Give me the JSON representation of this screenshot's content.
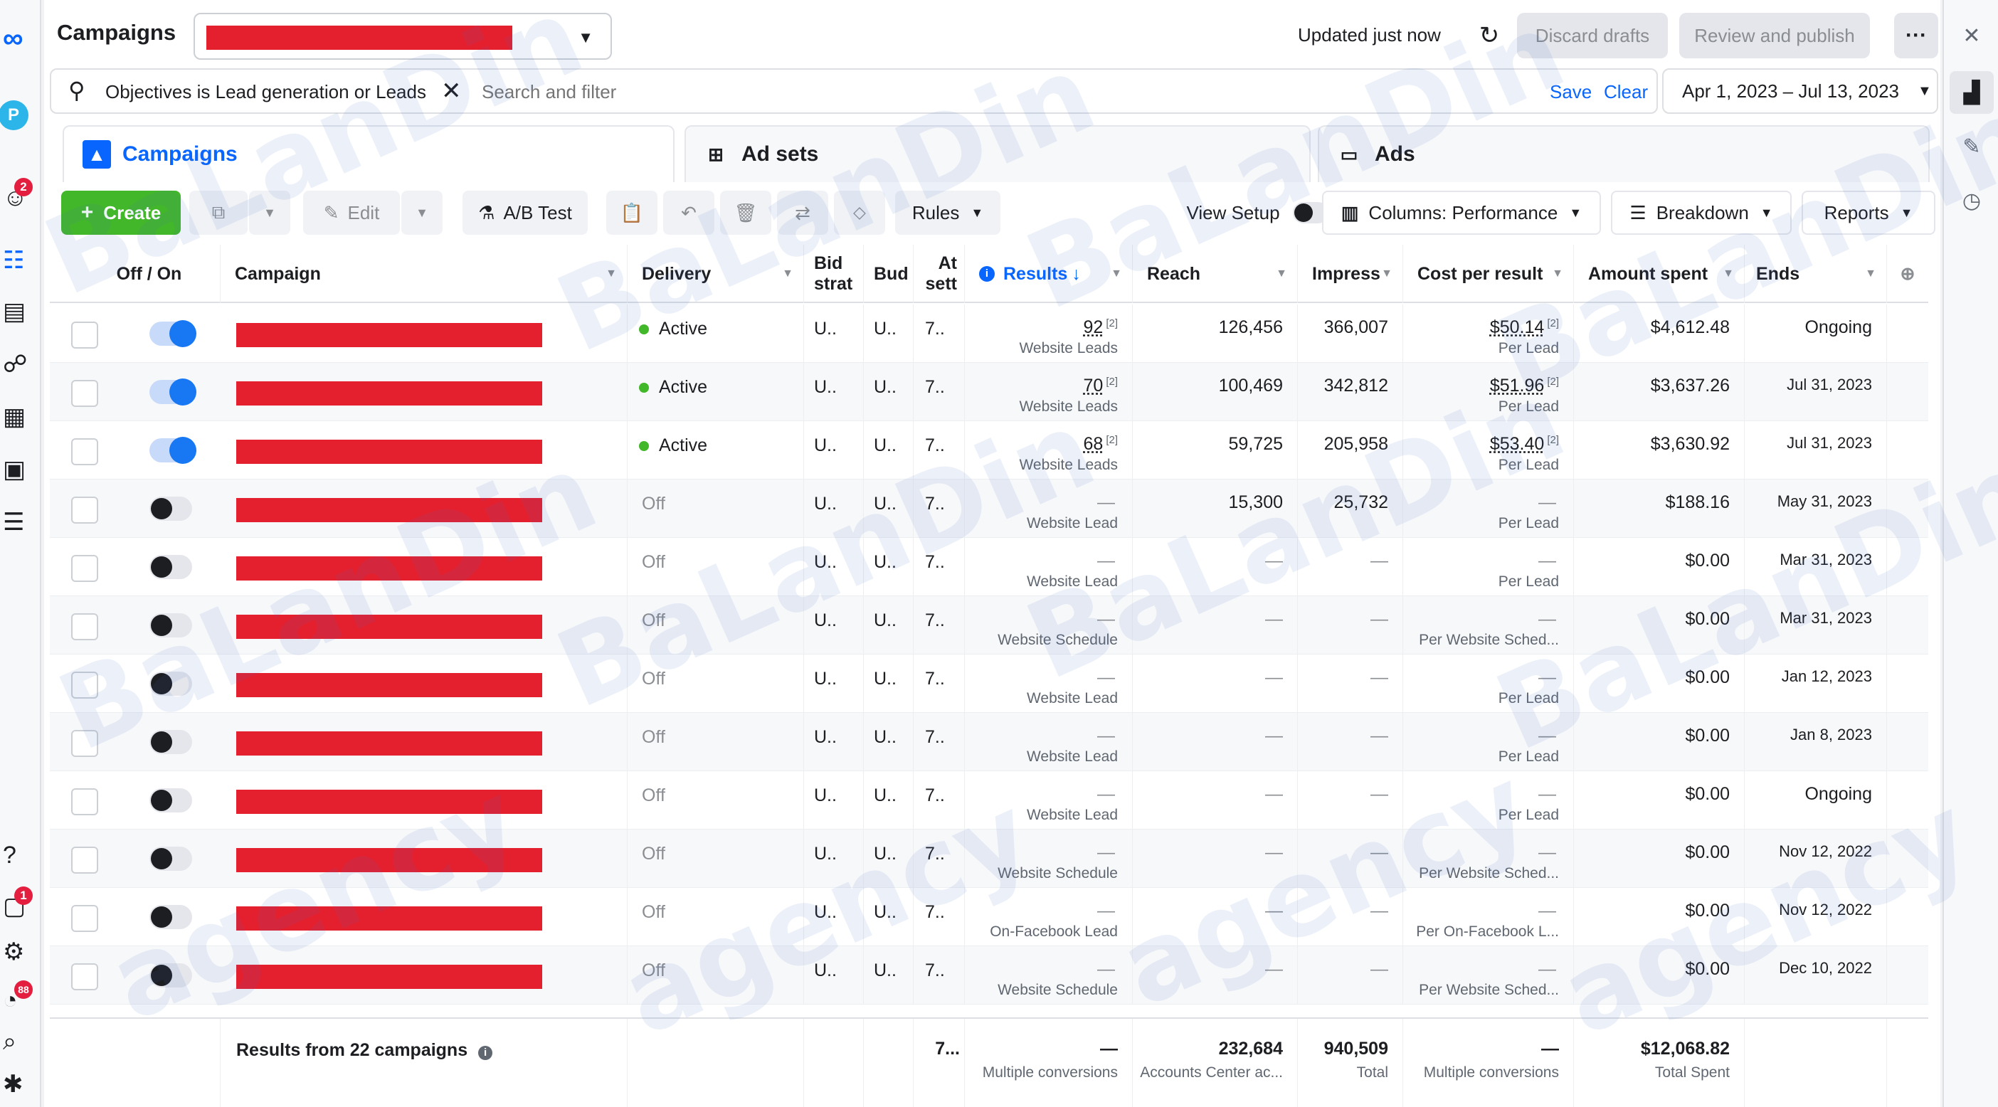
{
  "header": {
    "title": "Campaigns",
    "updated": "Updated just now",
    "discard_label": "Discard drafts",
    "review_label": "Review and publish",
    "more_label": "···"
  },
  "filter": {
    "chip_prefix": "Objectives is ",
    "chip_value": "Lead generation or Leads",
    "search_placeholder": "Search and filter",
    "save_label": "Save",
    "clear_label": "Clear",
    "date_range": "Apr 1, 2023 – Jul 13, 2023"
  },
  "tabs": {
    "campaigns": "Campaigns",
    "adsets": "Ad sets",
    "ads": "Ads"
  },
  "toolbar": {
    "create_label": "Create",
    "edit_label": "Edit",
    "ab_test_label": "A/B Test",
    "rules_label": "Rules",
    "view_setup_label": "View Setup",
    "columns_label": "Columns: Performance",
    "breakdown_label": "Breakdown",
    "reports_label": "Reports"
  },
  "columns": {
    "off_on": "Off / On",
    "campaign": "Campaign",
    "delivery": "Delivery",
    "bid_1": "Bid",
    "bid_2": "strat",
    "budget": "Bud",
    "attr_1": "At",
    "attr_2": "sett",
    "results": "Results",
    "reach": "Reach",
    "impressions": "Impress",
    "cost": "Cost per result",
    "amount": "Amount spent",
    "ends": "Ends"
  },
  "rows": [
    {
      "on": true,
      "delivery": "Active",
      "bid": "U..",
      "budget": "U..",
      "attr": "7..",
      "results": "92",
      "results_sup": "[2]",
      "results_type": "Website Leads",
      "reach": "126,456",
      "impressions": "366,007",
      "cost": "$50.14",
      "cost_sup": "[2]",
      "cost_type": "Per Lead",
      "amount": "$4,612.48",
      "ends": "Ongoing"
    },
    {
      "on": true,
      "delivery": "Active",
      "bid": "U..",
      "budget": "U..",
      "attr": "7..",
      "results": "70",
      "results_sup": "[2]",
      "results_type": "Website Leads",
      "reach": "100,469",
      "impressions": "342,812",
      "cost": "$51.96",
      "cost_sup": "[2]",
      "cost_type": "Per Lead",
      "amount": "$3,637.26",
      "ends": "Jul 31, 2023"
    },
    {
      "on": true,
      "delivery": "Active",
      "bid": "U..",
      "budget": "U..",
      "attr": "7..",
      "results": "68",
      "results_sup": "[2]",
      "results_type": "Website Leads",
      "reach": "59,725",
      "impressions": "205,958",
      "cost": "$53.40",
      "cost_sup": "[2]",
      "cost_type": "Per Lead",
      "amount": "$3,630.92",
      "ends": "Jul 31, 2023"
    },
    {
      "on": false,
      "delivery": "Off",
      "bid": "U..",
      "budget": "U..",
      "attr": "7..",
      "results": "—",
      "results_sup": "",
      "results_type": "Website Lead",
      "reach": "15,300",
      "impressions": "25,732",
      "cost": "—",
      "cost_sup": "",
      "cost_type": "Per Lead",
      "amount": "$188.16",
      "ends": "May 31, 2023"
    },
    {
      "on": false,
      "delivery": "Off",
      "bid": "U..",
      "budget": "U..",
      "attr": "7..",
      "results": "—",
      "results_sup": "",
      "results_type": "Website Lead",
      "reach": "—",
      "impressions": "—",
      "cost": "—",
      "cost_sup": "",
      "cost_type": "Per Lead",
      "amount": "$0.00",
      "ends": "Mar 31, 2023"
    },
    {
      "on": false,
      "delivery": "Off",
      "bid": "U..",
      "budget": "U..",
      "attr": "7..",
      "results": "—",
      "results_sup": "",
      "results_type": "Website Schedule",
      "reach": "—",
      "impressions": "—",
      "cost": "—",
      "cost_sup": "",
      "cost_type": "Per Website Sched...",
      "amount": "$0.00",
      "ends": "Mar 31, 2023"
    },
    {
      "on": false,
      "delivery": "Off",
      "bid": "U..",
      "budget": "U..",
      "attr": "7..",
      "results": "—",
      "results_sup": "",
      "results_type": "Website Lead",
      "reach": "—",
      "impressions": "—",
      "cost": "—",
      "cost_sup": "",
      "cost_type": "Per Lead",
      "amount": "$0.00",
      "ends": "Jan 12, 2023"
    },
    {
      "on": false,
      "delivery": "Off",
      "bid": "U..",
      "budget": "U..",
      "attr": "7..",
      "results": "—",
      "results_sup": "",
      "results_type": "Website Lead",
      "reach": "—",
      "impressions": "—",
      "cost": "—",
      "cost_sup": "",
      "cost_type": "Per Lead",
      "amount": "$0.00",
      "ends": "Jan 8, 2023"
    },
    {
      "on": false,
      "delivery": "Off",
      "bid": "U..",
      "budget": "U..",
      "attr": "7..",
      "results": "—",
      "results_sup": "",
      "results_type": "Website Lead",
      "reach": "—",
      "impressions": "—",
      "cost": "—",
      "cost_sup": "",
      "cost_type": "Per Lead",
      "amount": "$0.00",
      "ends": "Ongoing"
    },
    {
      "on": false,
      "delivery": "Off",
      "bid": "U..",
      "budget": "U..",
      "attr": "7..",
      "results": "—",
      "results_sup": "",
      "results_type": "Website Schedule",
      "reach": "—",
      "impressions": "—",
      "cost": "—",
      "cost_sup": "",
      "cost_type": "Per Website Sched...",
      "amount": "$0.00",
      "ends": "Nov 12, 2022"
    },
    {
      "on": false,
      "delivery": "Off",
      "bid": "U..",
      "budget": "U..",
      "attr": "7..",
      "results": "—",
      "results_sup": "",
      "results_type": "On-Facebook Lead",
      "reach": "—",
      "impressions": "—",
      "cost": "—",
      "cost_sup": "",
      "cost_type": "Per On-Facebook L...",
      "amount": "$0.00",
      "ends": "Nov 12, 2022"
    },
    {
      "on": false,
      "delivery": "Off",
      "bid": "U..",
      "budget": "U..",
      "attr": "7..",
      "results": "—",
      "results_sup": "",
      "results_type": "Website Schedule",
      "reach": "—",
      "impressions": "—",
      "cost": "—",
      "cost_sup": "",
      "cost_type": "Per Website Sched...",
      "amount": "$0.00",
      "ends": "Dec 10, 2022"
    }
  ],
  "footer": {
    "label": "Results from 22 campaigns",
    "attr": "7...",
    "results": "—",
    "results_sub": "Multiple conversions",
    "reach": "232,684",
    "reach_sub": "Accounts Center ac...",
    "impressions": "940,509",
    "impressions_sub": "Total",
    "cost": "—",
    "cost_sub": "Multiple conversions",
    "amount": "$12,068.82",
    "amount_sub": "Total Spent"
  },
  "rail": {
    "avatar_letter": "P",
    "badge_top": "2",
    "badge_mid": "1",
    "badge_low": "88",
    "help": "?"
  },
  "watermark": {
    "brand": "BaLanDin",
    "agency": "agency"
  },
  "colors": {
    "accent": "#0866ff",
    "create": "#42b72a",
    "active_dot": "#42b72a",
    "redaction": "#e5202e"
  }
}
